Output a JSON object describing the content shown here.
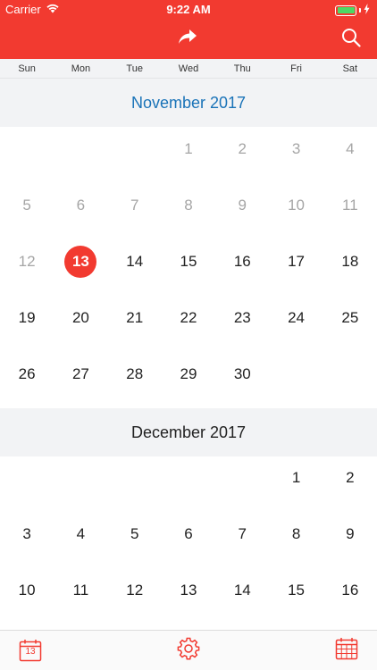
{
  "status_bar": {
    "carrier": "Carrier",
    "time": "9:22 AM"
  },
  "colors": {
    "accent": "#f23a30",
    "current_month": "#1a73b8",
    "battery": "#4cd964"
  },
  "header": {
    "icons": [
      "share-icon",
      "search-icon"
    ]
  },
  "weekdays": [
    "Sun",
    "Mon",
    "Tue",
    "Wed",
    "Thu",
    "Fri",
    "Sat"
  ],
  "months": [
    {
      "title": "November 2017",
      "is_current": true,
      "weeks": [
        [
          "",
          "",
          "",
          "1",
          "2",
          "3",
          "4"
        ],
        [
          "5",
          "6",
          "7",
          "8",
          "9",
          "10",
          "11"
        ],
        [
          "12",
          "13",
          "14",
          "15",
          "16",
          "17",
          "18"
        ],
        [
          "19",
          "20",
          "21",
          "22",
          "23",
          "24",
          "25"
        ],
        [
          "26",
          "27",
          "28",
          "29",
          "30",
          "",
          ""
        ]
      ],
      "past_days": [
        "1",
        "2",
        "3",
        "4",
        "5",
        "6",
        "7",
        "8",
        "9",
        "10",
        "11",
        "12"
      ],
      "today": "13"
    },
    {
      "title": "December 2017",
      "is_current": false,
      "weeks": [
        [
          "",
          "",
          "",
          "",
          "",
          "1",
          "2"
        ],
        [
          "3",
          "4",
          "5",
          "6",
          "7",
          "8",
          "9"
        ],
        [
          "10",
          "11",
          "12",
          "13",
          "14",
          "15",
          "16"
        ]
      ],
      "past_days": [],
      "today": ""
    }
  ],
  "tabbar": {
    "today_badge": "13",
    "icons": [
      "calendar-today-icon",
      "gear-icon",
      "calendar-grid-icon"
    ]
  }
}
